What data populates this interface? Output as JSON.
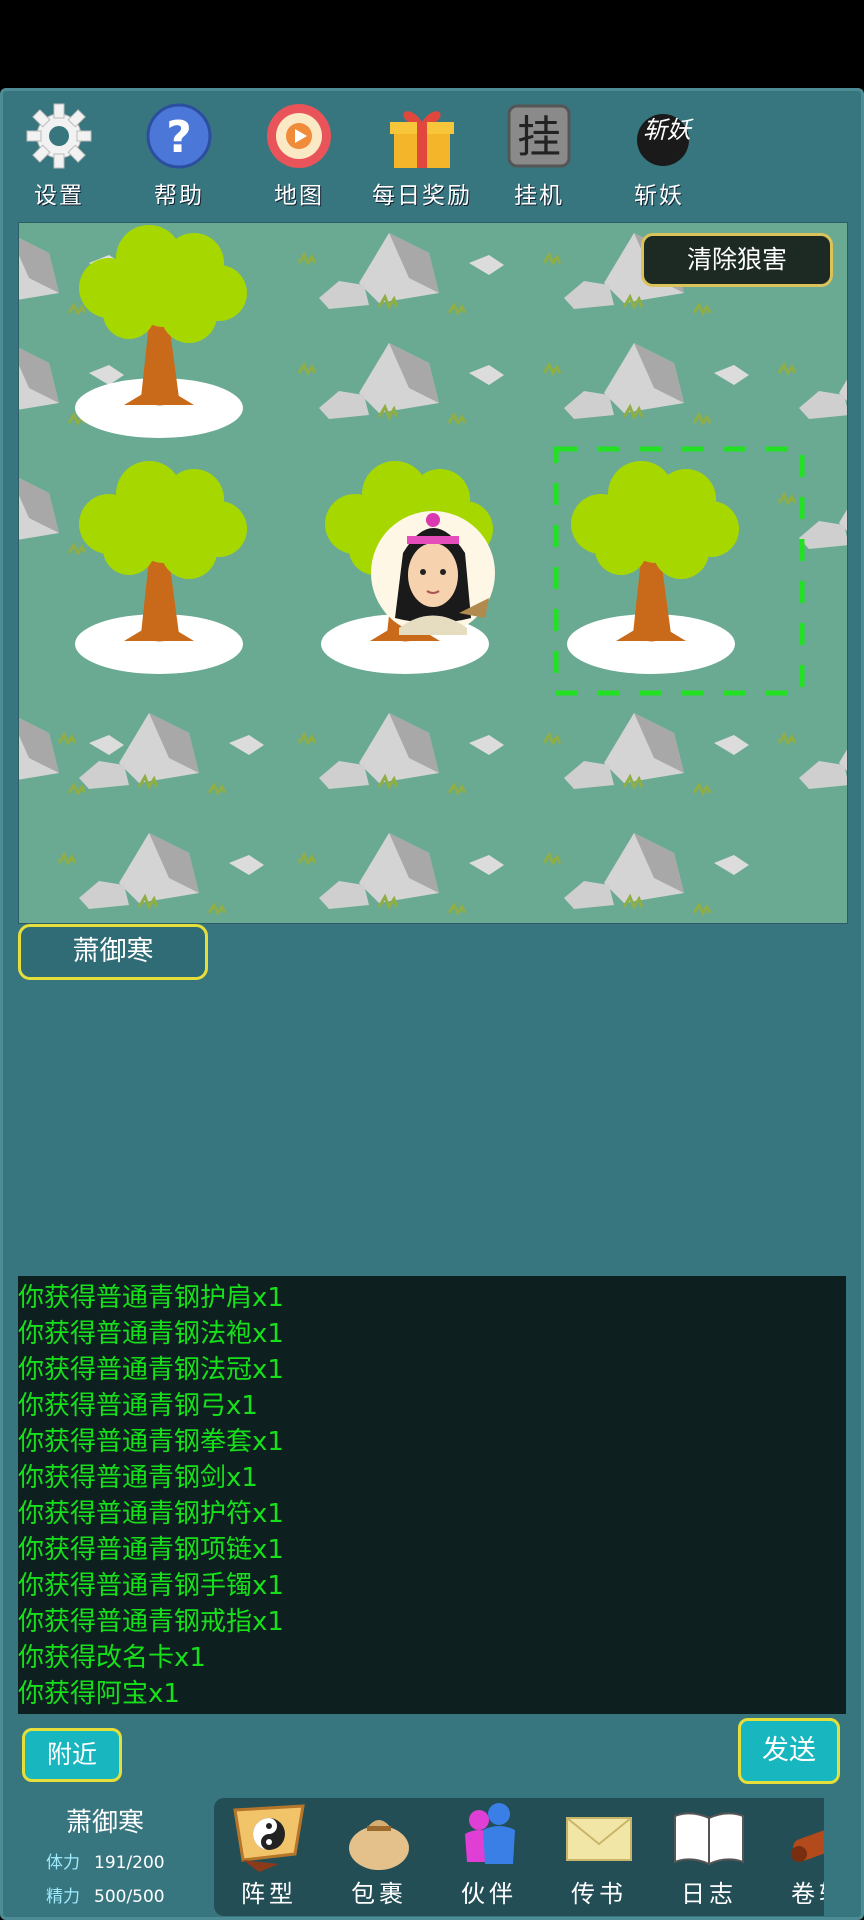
{
  "toolbar": {
    "items": [
      {
        "label": "设置",
        "icon": "gear-icon"
      },
      {
        "label": "帮助",
        "icon": "help-icon"
      },
      {
        "label": "地图",
        "icon": "map-icon"
      },
      {
        "label": "每日奖励",
        "icon": "gift-icon"
      },
      {
        "label": "挂机",
        "icon": "idle-icon"
      },
      {
        "label": "斩妖",
        "icon": "slay-demon-icon"
      }
    ],
    "slay_badge_text": "斩妖"
  },
  "map": {
    "clear_button_label": "清除狼害"
  },
  "character": {
    "name": "萧御寒"
  },
  "log": {
    "lines": [
      "你获得普通青钢护肩x1",
      "你获得普通青钢法袍x1",
      "你获得普通青钢法冠x1",
      "你获得普通青钢弓x1",
      "你获得普通青钢拳套x1",
      "你获得普通青钢剑x1",
      "你获得普通青钢护符x1",
      "你获得普通青钢项链x1",
      "你获得普通青钢手镯x1",
      "你获得普通青钢戒指x1",
      "你获得改名卡x1",
      "你获得阿宝x1"
    ]
  },
  "chat": {
    "nearby_label": "附近",
    "send_label": "发送"
  },
  "player": {
    "name": "萧御寒",
    "stamina_label": "体力",
    "stamina_value": "191/200",
    "energy_label": "精力",
    "energy_value": "500/500"
  },
  "dock": {
    "items": [
      {
        "label": "阵型",
        "icon": "formation-icon"
      },
      {
        "label": "包裹",
        "icon": "bag-icon"
      },
      {
        "label": "伙伴",
        "icon": "partners-icon"
      },
      {
        "label": "传书",
        "icon": "mail-icon"
      },
      {
        "label": "日志",
        "icon": "journal-icon"
      },
      {
        "label": "卷轴",
        "icon": "scroll-icon"
      }
    ]
  },
  "colors": {
    "background": "#38767f",
    "log_text": "#17e01b",
    "button_border": "#e6de3a",
    "button_fill": "#18b7c0",
    "selection": "#22e022"
  }
}
